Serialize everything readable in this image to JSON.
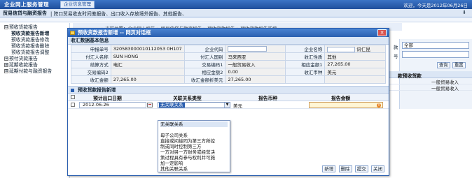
{
  "app": {
    "title": "企业网上服务管理",
    "top_tab": "企业信息管理",
    "user_info": "欢迎，今天是2012年06月26日"
  },
  "nav": {
    "active": "贸易信贷与融资报告",
    "rest": "| 跨口贸易收支时间差报告、出口收入存放境外报告、其他报告、",
    "arrow": "⬇"
  },
  "tree": {
    "items": [
      {
        "label": "预收货款报告",
        "pm": "⊟",
        "level": 0
      },
      {
        "label": "预收货款报告新增",
        "level": 1,
        "selected": true
      },
      {
        "label": "预收货款报告修改",
        "level": 1
      },
      {
        "label": "预收货款报告删除",
        "level": 1
      },
      {
        "label": "预收货款报告调整",
        "level": 1
      },
      {
        "label": "预付货款报告",
        "pm": "⊞",
        "level": 0
      },
      {
        "label": "延期收款报告",
        "pm": "⊞",
        "level": 0
      },
      {
        "label": "延期付款与融资报告",
        "pm": "⊞",
        "level": 0
      }
    ]
  },
  "background": {
    "breadcrumb": "» 当前位置：企业网上报告 » 贸易信贷与融资报告 » 预收货款报告 » 预收货款报告新增",
    "filter_label1": "款",
    "filter_select": "全部",
    "filter_label2": "号",
    "query_btn": "查询",
    "reset_btn": "重置",
    "grid_header": "款预收货款",
    "grid_rows": [
      "一般贸易收入",
      "一般贸易收入"
    ]
  },
  "modal": {
    "title": "预收货款报告新增 -- 网页对话框",
    "close": "✕",
    "section1": "收汇数据基本信息",
    "rows": [
      [
        "申报单号",
        "320583000010112053 0H107",
        "企业代码",
        "",
        "企业名称",
        "诚信工贸有限责任公司"
      ],
      [
        "付汇人名称",
        "SUN HONG",
        "付汇人国别",
        "马来西亚",
        "收汇性质",
        "其他"
      ],
      [
        "结算方式",
        "电汇",
        "交易编码1",
        "一般贸易收入",
        "相应金额1",
        "27,265.00"
      ],
      [
        "交易编码2",
        "",
        "相应金额2",
        "0.00",
        "收汇币种",
        "美元"
      ],
      [
        "收汇金额",
        "27,265.00",
        "收汇金额折美元",
        "27,265.00",
        "",
        ""
      ]
    ],
    "section2": "预收货款报告新增",
    "grid": {
      "headers": [
        "预计出口日期",
        "关联关系类型",
        "报告币种",
        "报告金额"
      ],
      "row": {
        "date": "2012-06-26",
        "relation": "无关联关系",
        "currency": "美元",
        "amount": ""
      }
    },
    "dropdown_options": [
      "无关联关系",
      "",
      "母子公司关系",
      "直接或间接同为第三方所控",
      "制或同时控制第三方",
      "一方对另一方财务或经营决",
      "策过程具有参与权利并可施",
      "加一定影响",
      "其他关联关系"
    ],
    "buttons": {
      "add": "新增",
      "delete": "删除",
      "submit": "提交",
      "close": "关闭"
    }
  }
}
